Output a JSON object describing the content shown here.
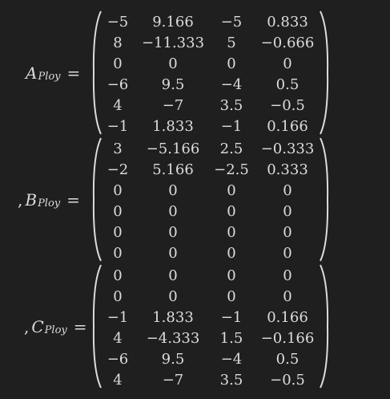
{
  "matrices": [
    {
      "name": "A",
      "subscript": "Ploy",
      "prefix": "",
      "rows": [
        [
          "−5",
          "9.166",
          "−5",
          "0.833"
        ],
        [
          "8",
          "−11.333",
          "5",
          "−0.666"
        ],
        [
          "0",
          "0",
          "0",
          "0"
        ],
        [
          "−6",
          "9.5",
          "−4",
          "0.5"
        ],
        [
          "4",
          "−7",
          "3.5",
          "−0.5"
        ],
        [
          "−1",
          "1.833",
          "−1",
          "0.166"
        ]
      ]
    },
    {
      "name": "B",
      "subscript": "Ploy",
      "prefix": ",",
      "rows": [
        [
          "3",
          "−5.166",
          "2.5",
          "−0.333"
        ],
        [
          "−2",
          "5.166",
          "−2.5",
          "0.333"
        ],
        [
          "0",
          "0",
          "0",
          "0"
        ],
        [
          "0",
          "0",
          "0",
          "0"
        ],
        [
          "0",
          "0",
          "0",
          "0"
        ],
        [
          "0",
          "0",
          "0",
          "0"
        ]
      ]
    },
    {
      "name": "C",
      "subscript": "Ploy",
      "prefix": ",",
      "rows": [
        [
          "0",
          "0",
          "0",
          "0"
        ],
        [
          "0",
          "0",
          "0",
          "0"
        ],
        [
          "−1",
          "1.833",
          "−1",
          "0.166"
        ],
        [
          "4",
          "−4.333",
          "1.5",
          "−0.166"
        ],
        [
          "−6",
          "9.5",
          "−4",
          "0.5"
        ],
        [
          "4",
          "−7",
          "3.5",
          "−0.5"
        ]
      ]
    }
  ],
  "equals_sign": "="
}
